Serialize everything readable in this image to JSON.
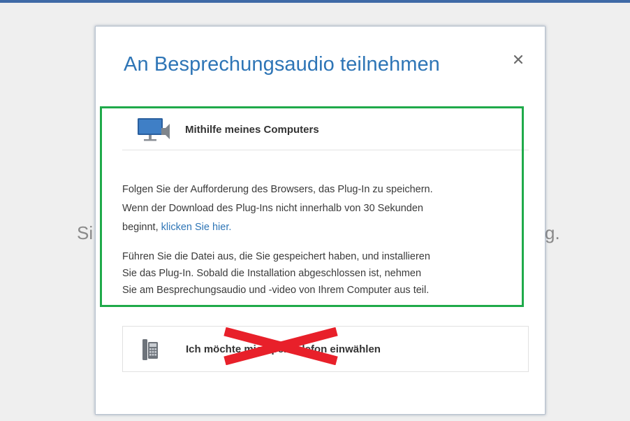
{
  "background": {
    "text_left": "Si",
    "text_right": "g."
  },
  "dialog": {
    "title": "An Besprechungsaudio teilnehmen",
    "close_symbol": "×",
    "computer_option": {
      "icon": "monitor-speaker-icon",
      "label": "Mithilfe meines Computers"
    },
    "instructions": {
      "line1": "Folgen Sie der Aufforderung des Browsers, das Plug-In zu speichern.",
      "line2": "Wenn der Download des Plug-Ins nicht innerhalb von 30 Sekunden",
      "line3_prefix": "beginnt, ",
      "link_text": "klicken Sie hier.",
      "para2_line1": "Führen Sie die Datei aus, die Sie gespeichert haben, und installieren",
      "para2_line2": "Sie das Plug-In. Sobald die Installation abgeschlossen ist, nehmen",
      "para2_line3": "Sie am Besprechungsaudio und -video von Ihrem Computer aus teil."
    },
    "phone_option": {
      "icon": "desk-phone-icon",
      "label": "Ich möchte mich per Telefon einwählen"
    }
  },
  "annotations": {
    "highlight_color": "#1faa4a",
    "cross_color": "#e8202a"
  },
  "colors": {
    "title_blue": "#2e75b6",
    "link_blue": "#2e75b6",
    "top_border": "#3f6aa6"
  }
}
